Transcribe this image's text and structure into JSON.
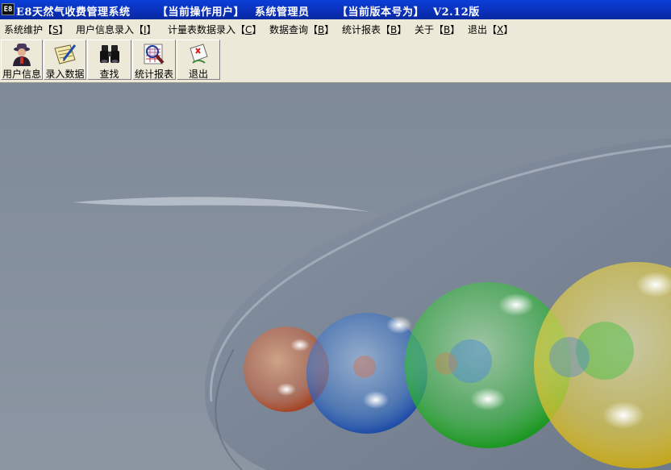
{
  "titlebar": {
    "app_icon_text": "E8",
    "app_name": "E8天然气收费管理系统",
    "user_label": "【当前操作用户】",
    "user_value": "系统管理员",
    "version_label": "【当前版本号为】",
    "version_value": "V2.12版"
  },
  "menu": [
    {
      "label": "系统维护",
      "hotkey": "S"
    },
    {
      "label": "用户信息录入",
      "hotkey": "I"
    },
    {
      "label": "计量表数据录入",
      "hotkey": "C"
    },
    {
      "label": "数据查询",
      "hotkey": "B"
    },
    {
      "label": "统计报表",
      "hotkey": "B"
    },
    {
      "label": "关于",
      "hotkey": "B"
    },
    {
      "label": "退出",
      "hotkey": "X"
    }
  ],
  "toolbar": [
    {
      "label": "用户信息",
      "icon": "user-info-icon"
    },
    {
      "label": "录入数据",
      "icon": "data-entry-icon"
    },
    {
      "label": "查找",
      "icon": "binoculars-icon"
    },
    {
      "label": "统计报表",
      "icon": "report-magnifier-icon"
    },
    {
      "label": "退出",
      "icon": "exit-icon"
    }
  ],
  "colors": {
    "titlebar": "#0a2fb8",
    "menubar": "#ece9d8",
    "desktop": "#7d8896"
  }
}
